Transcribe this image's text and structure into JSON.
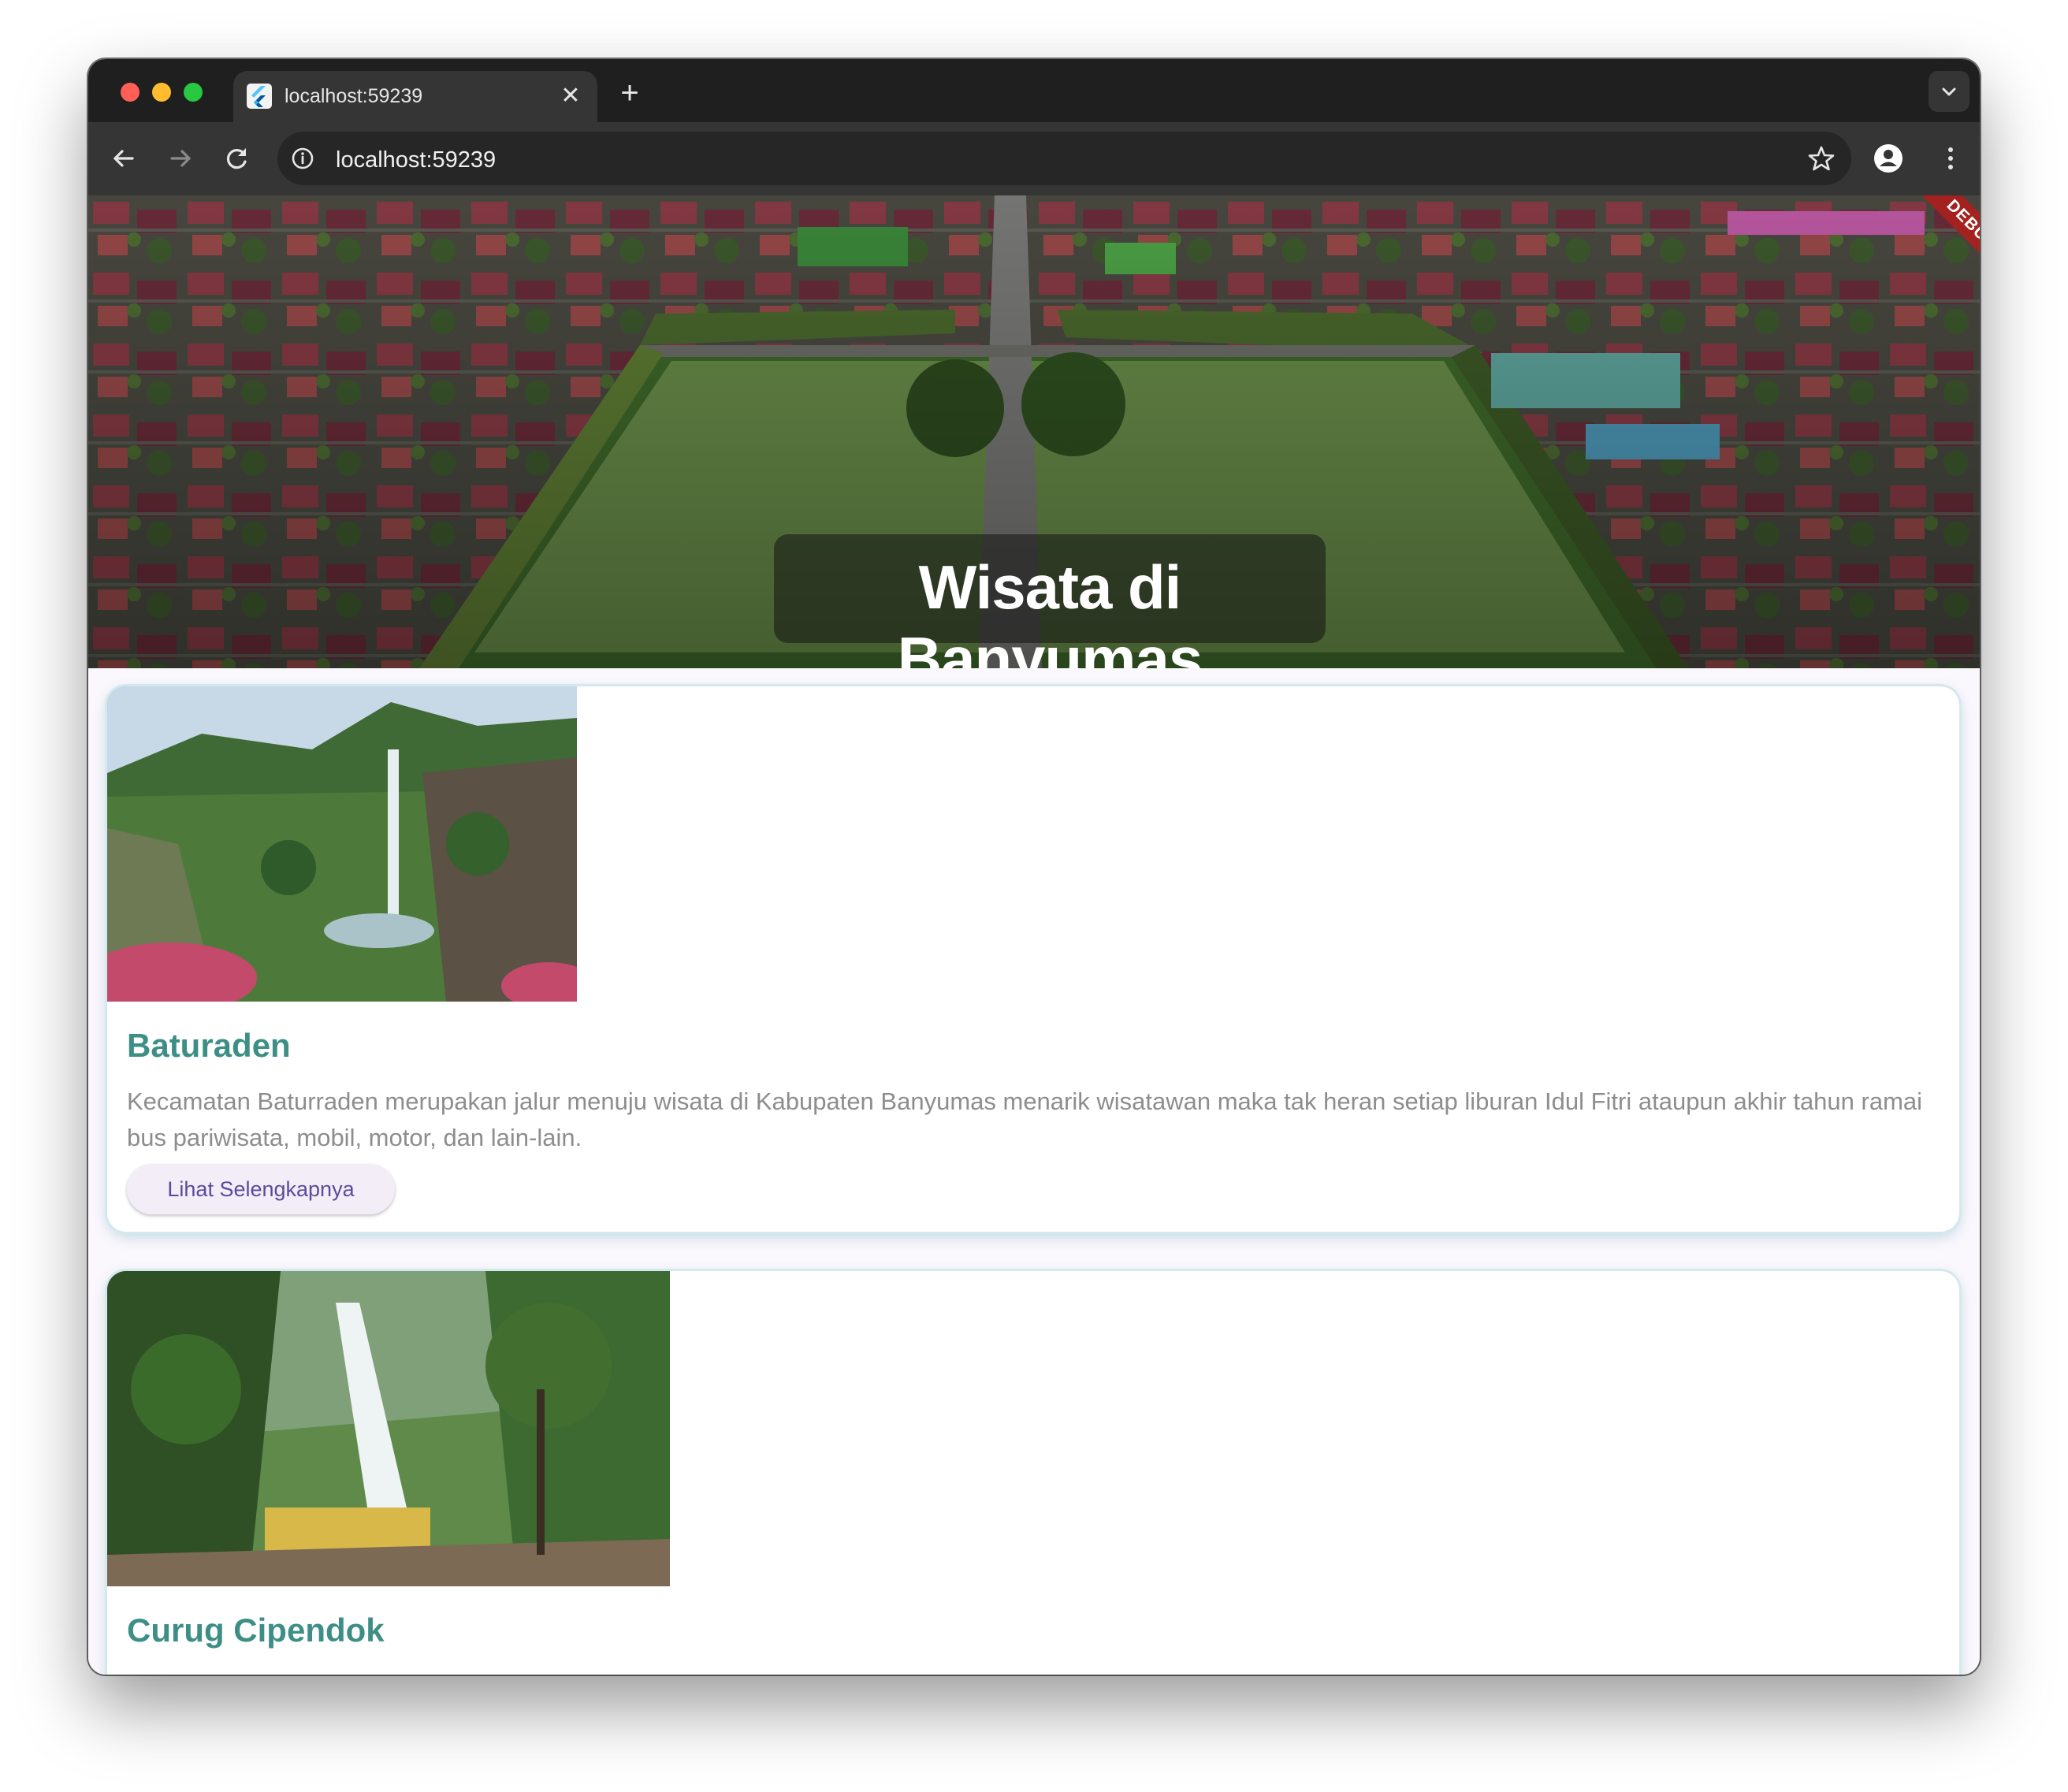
{
  "browser": {
    "tab_title": "localhost:59239",
    "url": "localhost:59239",
    "close_glyph": "✕",
    "newtab_glyph": "+"
  },
  "app": {
    "hero_title": "Wisata di Banyumas",
    "debug_label": "DEBUG"
  },
  "destinations": [
    {
      "name": "Baturaden",
      "description": "Kecamatan Baturraden merupakan jalur menuju wisata di Kabupaten Banyumas menarik wisatawan maka tak heran setiap liburan Idul Fitri ataupun akhir tahun ramai bus pariwisata, mobil, motor, dan lain-lain.",
      "button_label": "Lihat Selengkapnya"
    },
    {
      "name": "Curug Cipendok"
    }
  ],
  "colors": {
    "title_teal": "#3d8f86",
    "button_text": "#5d4a9a",
    "debug_red": "#a3211e"
  },
  "icons": [
    "back-arrow-icon",
    "forward-arrow-icon",
    "reload-icon",
    "info-icon",
    "star-icon",
    "profile-icon",
    "kebab-menu-icon",
    "chevron-down-icon",
    "flutter-favicon"
  ]
}
